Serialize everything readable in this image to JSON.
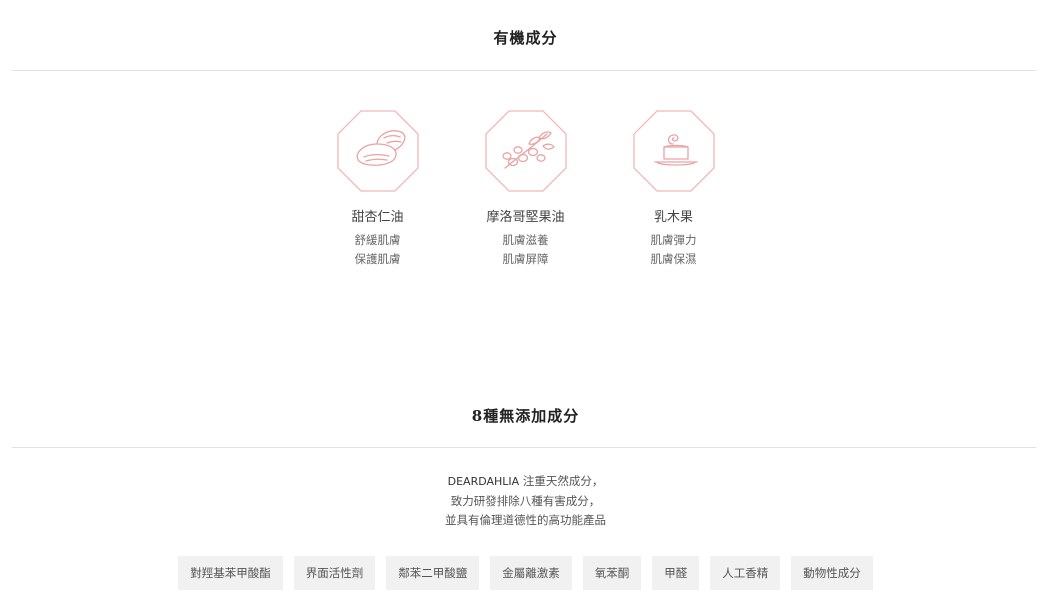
{
  "organic_section": {
    "title": "有機成分",
    "items": [
      {
        "name": "甜杏仁油",
        "benefits": [
          "舒緩肌膚",
          "保護肌膚"
        ],
        "icon": "almond-icon"
      },
      {
        "name": "摩洛哥堅果油",
        "benefits": [
          "肌膚滋養",
          "肌膚屏障"
        ],
        "icon": "argan-branch-icon"
      },
      {
        "name": "乳木果",
        "benefits": [
          "肌膚彈力",
          "肌膚保濕"
        ],
        "icon": "shea-butter-icon"
      }
    ]
  },
  "free_from_section": {
    "title": "8種無添加成分",
    "intro_brand": "DEARDAHLIA",
    "intro_line1_rest": " 注重天然成分，",
    "intro_line2": "致力研發排除八種有害成分，",
    "intro_line3": "並具有倫理道德性的高功能產品",
    "tags": [
      "對羥基苯甲酸酯",
      "界面活性劑",
      "鄰苯二甲酸鹽",
      "金屬離激素",
      "氧苯酮",
      "甲醛",
      "人工香精",
      "動物性成分"
    ]
  },
  "colors": {
    "icon_stroke": "#f2b8b8",
    "tag_bg": "#f1f1f1",
    "divider": "#e2e2e2"
  }
}
